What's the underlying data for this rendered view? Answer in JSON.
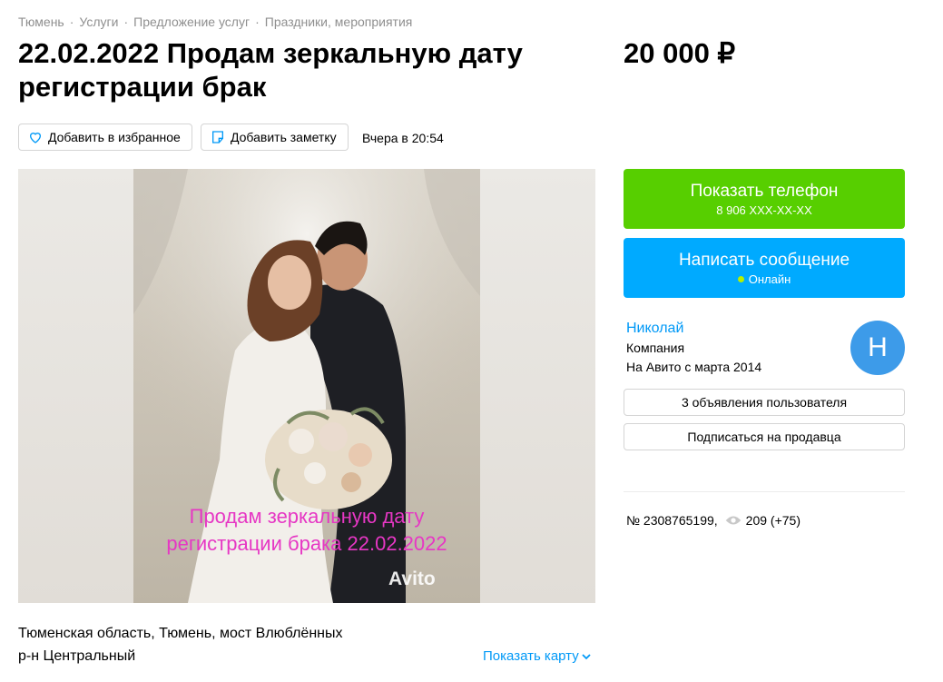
{
  "breadcrumbs": [
    "Тюмень",
    "Услуги",
    "Предложение услуг",
    "Праздники, мероприятия"
  ],
  "breadcrumb_separator": "·",
  "listing": {
    "title": "22.02.2022 Продам зеркальную дату регистрации брак",
    "price": "20 000 ₽",
    "posted": "Вчера в 20:54"
  },
  "toolbar": {
    "favorite_label": "Добавить в избранное",
    "note_label": "Добавить заметку"
  },
  "photo": {
    "caption_line1": "Продам зеркальную дату",
    "caption_line2": "регистрации брака 22.02.2022",
    "watermark": "Avito"
  },
  "contact": {
    "phone_label": "Показать телефон",
    "phone_masked": "8 906 XXX-XX-XX",
    "message_label": "Написать сообщение",
    "online_label": "Онлайн"
  },
  "seller": {
    "name": "Николай",
    "type": "Компания",
    "since": "На Авито с марта 2014",
    "avatar_letter": "Н",
    "ads_button": "3 объявления пользователя",
    "subscribe_button": "Подписаться на продавца"
  },
  "stats": {
    "number": "№ 2308765199,",
    "views": "209 (+75)"
  },
  "location": {
    "address": "Тюменская область, Тюмень, мост Влюблённых",
    "district": "р-н Центральный",
    "map_link": "Показать карту"
  },
  "colors": {
    "phone_button": "#57cf00",
    "message_button": "#00aaff",
    "link": "#0099f7",
    "avatar": "#3d9be9",
    "caption": "#e637c4"
  }
}
